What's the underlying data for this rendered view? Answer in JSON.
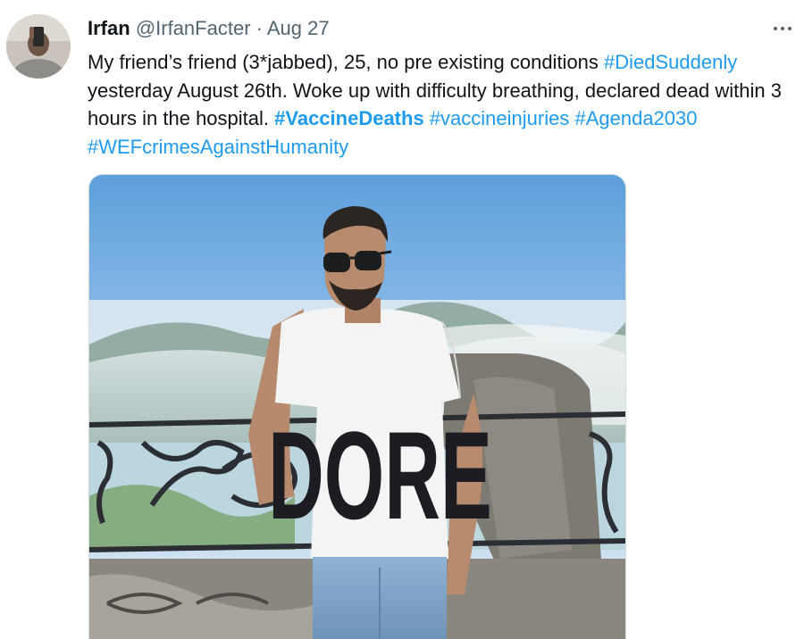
{
  "author": {
    "name": "Irfan",
    "handle": "@IrfanFacter",
    "separator": "·",
    "date": "Aug 27",
    "avatar_icon": "profile-photo"
  },
  "more_icon": "ellipsis-icon",
  "tweet": {
    "text_before": "My friend’s friend (3*jabbed), 25, no pre existing conditions ",
    "tag1": "#DiedSuddenly",
    "text_middle": " yesterday August 26th. Woke up with difficulty breathing, declared dead within 3 hours in the hospital. ",
    "tag2": "#VaccineDeaths",
    "tag3": "#vaccineinjuries",
    "tag4": "#Agenda2030",
    "tag5": "#WEFcrimesAgainstHumanity"
  },
  "media": {
    "shirt_text": "DORE",
    "colors": {
      "sky": "#7fb6e4",
      "link": "#1d9bf0",
      "text": "#0f1419",
      "muted": "#536471"
    }
  }
}
